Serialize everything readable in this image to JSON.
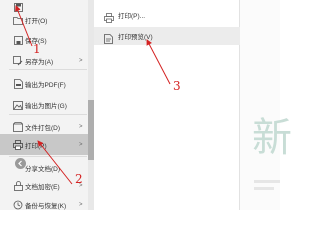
{
  "menu": {
    "items": [
      {
        "label": "",
        "icon": "save-icon",
        "arrow": false
      },
      {
        "label": "打开(O)",
        "icon": "folder-icon",
        "arrow": false
      },
      {
        "label": "保存(S)",
        "icon": "save-icon",
        "arrow": false
      },
      {
        "label": "另存为(A)",
        "icon": "save-as-icon",
        "arrow": true
      },
      {
        "label": "输出为PDF(F)",
        "icon": "pdf-icon",
        "arrow": false
      },
      {
        "label": "输出为图片(G)",
        "icon": "image-icon",
        "arrow": false
      },
      {
        "label": "文件打包(D)",
        "icon": "package-icon",
        "arrow": true
      },
      {
        "label": "打印(P)",
        "icon": "printer-icon",
        "arrow": true
      },
      {
        "label": "分享文档(D)",
        "icon": "share-icon",
        "arrow": false
      },
      {
        "label": "文档加密(E)",
        "icon": "lock-icon",
        "arrow": true
      },
      {
        "label": "备份与恢复(K)",
        "icon": "backup-icon",
        "arrow": true
      }
    ],
    "arrow_glyph": ">"
  },
  "submenu": {
    "items": [
      {
        "label": "打印(P)...",
        "icon": "printer-icon"
      },
      {
        "label": "打印预览(V)",
        "icon": "print-preview-icon"
      }
    ]
  },
  "document": {
    "glyph": "新"
  },
  "annotations": {
    "step1": "1",
    "step2": "2",
    "step3": "3",
    "color": "#d42222"
  },
  "colors": {
    "menu_bg": "#f3f3f3",
    "active_item": "#c8c8c8",
    "doc_glyph": "#c8ddd6"
  }
}
